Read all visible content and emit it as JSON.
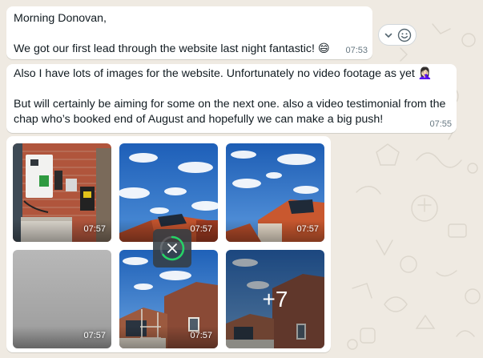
{
  "messages": [
    {
      "text": "Morning Donovan,\n\nWe got our first lead through the website last night fantastic! 😄",
      "time": "07:53"
    },
    {
      "text": "Also I have lots of images for the website. Unfortunately no video footage as yet 🤦🏻‍♀️\n\nBut will certainly be aiming for some on the next one. also a video testimonial from the chap who’s booked end of August and hopefully we can make a big push!",
      "time": "07:55"
    }
  ],
  "gallery": {
    "tiles": [
      {
        "time": "07:57",
        "subject": "garage-inverter-battery"
      },
      {
        "time": "07:57",
        "subject": "sky-roof-panels"
      },
      {
        "time": "07:57",
        "subject": "sky-roof-panels"
      },
      {
        "time": "07:57",
        "subject": "uploading-placeholder"
      },
      {
        "time": "07:57",
        "subject": "house-scaffold"
      },
      {
        "time": "07:57",
        "subject": "house-scaffold"
      }
    ],
    "more_count": "+7"
  },
  "icons": {
    "reaction": "chevron-down-icon",
    "emoji": "emoji-smiley-icon",
    "cancel": "close-icon"
  },
  "colors": {
    "chat_background": "#efeae2",
    "bubble": "#ffffff",
    "timestamp": "#667781",
    "upload_progress": "#25d366"
  }
}
